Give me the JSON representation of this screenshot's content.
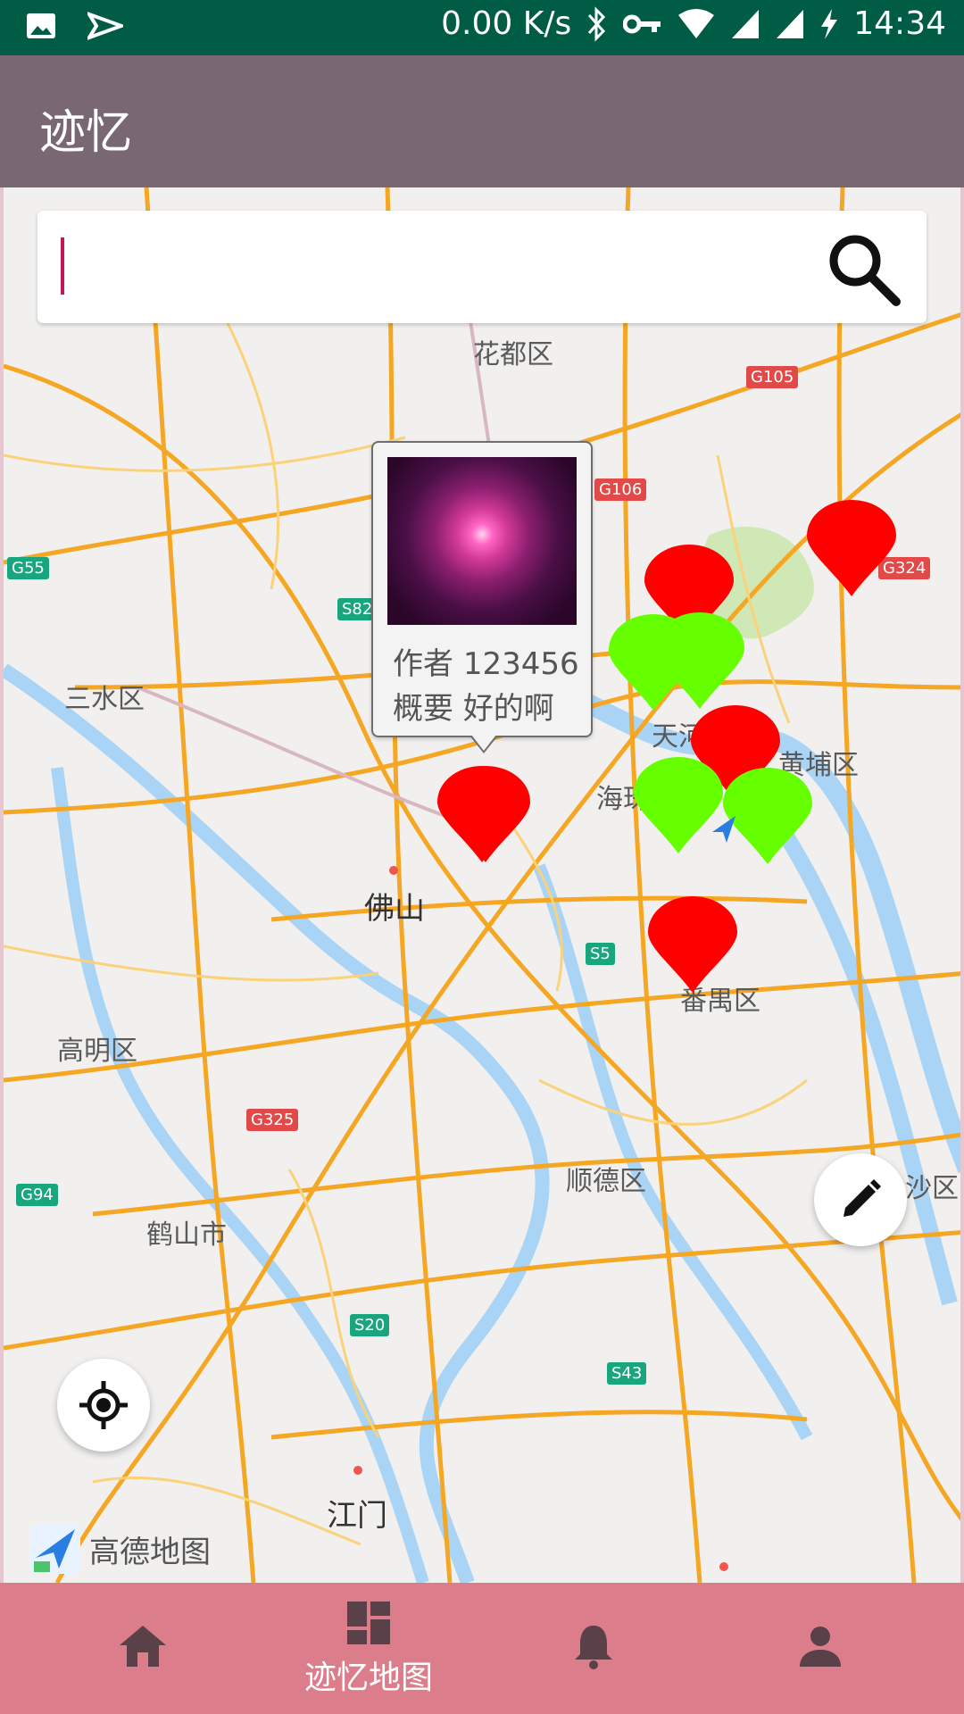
{
  "status_bar": {
    "net_speed": "0.00 K/s",
    "time": "14:34"
  },
  "app_bar": {
    "title": "迹忆"
  },
  "search": {
    "value": "",
    "placeholder": ""
  },
  "map": {
    "attribution": "高德地图",
    "place_labels": [
      "花都区",
      "三水区",
      "佛山",
      "高明区",
      "顺德区",
      "鹤山市",
      "江门",
      "黄埔区",
      "番禺区",
      "海珠",
      "天河",
      "沙区"
    ],
    "road_shields": [
      "G105",
      "G106",
      "G55",
      "S82",
      "G324",
      "S5",
      "G325",
      "G94",
      "S20",
      "S43"
    ],
    "popup": {
      "author_label": "作者",
      "author_value": "123456",
      "summary_label": "概要",
      "summary_value": "好的啊"
    },
    "marker_colors": {
      "red": "#ff0000",
      "green": "#66ff00"
    }
  },
  "bottom_nav": {
    "items": [
      {
        "label": "",
        "icon": "home-icon"
      },
      {
        "label": "迹忆地图",
        "icon": "dashboard-icon"
      },
      {
        "label": "",
        "icon": "bell-icon"
      },
      {
        "label": "",
        "icon": "person-icon"
      }
    ]
  }
}
